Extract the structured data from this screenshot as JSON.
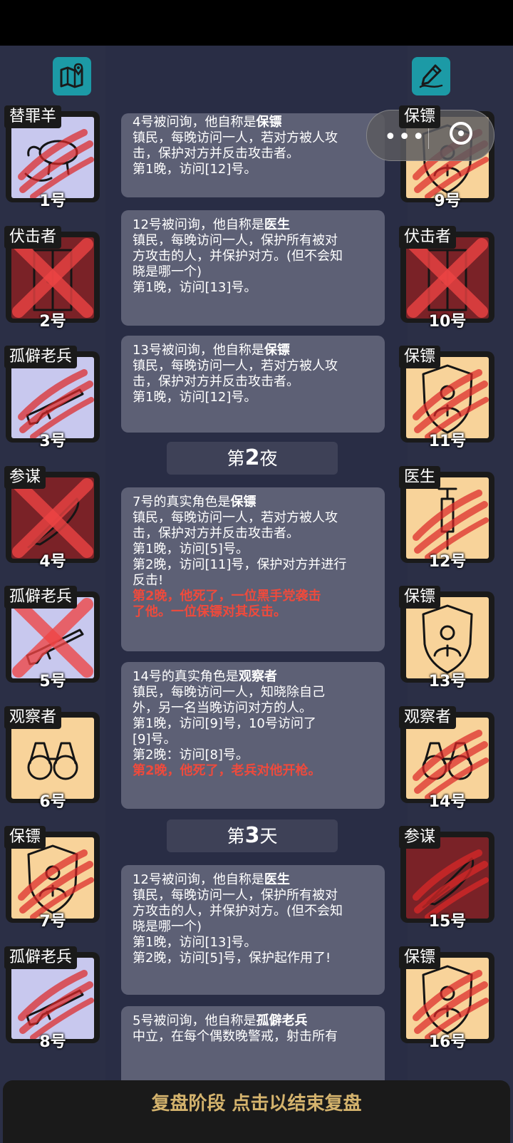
{
  "top_buttons": {
    "left_icon": "map-icon",
    "right_icon": "edit-icon"
  },
  "left_players": [
    {
      "tag": "替罪羊",
      "num": "1号",
      "icon": "goat",
      "bg": "#c8c8ee",
      "status": "scratch"
    },
    {
      "tag": "伏击者",
      "num": "2号",
      "icon": "door",
      "bg": "#7a2227",
      "status": "cross"
    },
    {
      "tag": "孤僻老兵",
      "num": "3号",
      "icon": "rifle",
      "bg": "#c8c8ee",
      "status": "scratch"
    },
    {
      "tag": "参谋",
      "num": "4号",
      "icon": "quill",
      "bg": "#7a2227",
      "status": "cross"
    },
    {
      "tag": "孤僻老兵",
      "num": "5号",
      "icon": "rifle",
      "bg": "#c8c8ee",
      "status": "cross"
    },
    {
      "tag": "观察者",
      "num": "6号",
      "icon": "binoculars",
      "bg": "#f8d39a",
      "status": "none"
    },
    {
      "tag": "保镖",
      "num": "7号",
      "icon": "shield",
      "bg": "#f8d39a",
      "status": "scratch"
    },
    {
      "tag": "孤僻老兵",
      "num": "8号",
      "icon": "rifle",
      "bg": "#c8c8ee",
      "status": "scratch"
    }
  ],
  "right_players": [
    {
      "tag": "保镖",
      "num": "9号",
      "icon": "shield",
      "bg": "#f8d39a",
      "status": "scratch"
    },
    {
      "tag": "伏击者",
      "num": "10号",
      "icon": "door",
      "bg": "#7a2227",
      "status": "cross"
    },
    {
      "tag": "保镖",
      "num": "11号",
      "icon": "shield",
      "bg": "#f8d39a",
      "status": "scratch"
    },
    {
      "tag": "医生",
      "num": "12号",
      "icon": "syringe",
      "bg": "#f8d39a",
      "status": "scratch"
    },
    {
      "tag": "保镖",
      "num": "13号",
      "icon": "shield",
      "bg": "#f8d39a",
      "status": "none"
    },
    {
      "tag": "观察者",
      "num": "14号",
      "icon": "binoculars",
      "bg": "#f8d39a",
      "status": "scratch"
    },
    {
      "tag": "参谋",
      "num": "15号",
      "icon": "quill",
      "bg": "#7a2227",
      "status": "scratch"
    },
    {
      "tag": "保镖",
      "num": "16号",
      "icon": "shield",
      "bg": "#f8d39a",
      "status": "scratch"
    }
  ],
  "log": {
    "card1": {
      "l1a": "4号被问询，他自称是",
      "l1b": "保镖",
      "l2": "镇民，每晚访问一人，若对方被人攻",
      "l3": "击，保护对方并反击攻击者。",
      "l4": "第1晚，访问[12]号。"
    },
    "card2": {
      "l1a": "12号被问询，他自称是",
      "l1b": "医生",
      "l2": "镇民，每晚访问一人，保护所有被对",
      "l3": "方攻击的人，并保护对方。(但不会知",
      "l4": "晓是哪一个)",
      "l5": "第1晚，访问[13]号。"
    },
    "card3": {
      "l1a": "13号被问询，他自称是",
      "l1b": "保镖",
      "l2": "镇民，每晚访问一人，若对方被人攻",
      "l3": "击，保护对方并反击攻击者。",
      "l4": "第1晚，访问[12]号。"
    },
    "header1": {
      "pre": "第",
      "num": "2",
      "post": "夜"
    },
    "card4": {
      "l1a": "7号的真实角色是",
      "l1b": "保镖",
      "l2": "镇民，每晚访问一人，若对方被人攻",
      "l3": "击，保护对方并反击攻击者。",
      "l4": "第1晚，访问[5]号。",
      "l5": "第2晚，访问[11]号，保护对方并进行",
      "l6": "反击!",
      "r1": "第2晚，他死了，一位黑手党袭击",
      "r2": "了他。一位保镖对其反击。"
    },
    "card5": {
      "l1a": "14号的真实角色是",
      "l1b": "观察者",
      "l2": "镇民，每晚访问一人，知晓除自己",
      "l3": "外，另一名当晚访问对方的人。",
      "l4": "第1晚，访问[9]号，10号访问了",
      "l5": "[9]号。",
      "l6": "第2晚：访问[8]号。",
      "r1": "第2晚，他死了，老兵对他开枪。"
    },
    "header2": {
      "pre": "第",
      "num": "3",
      "post": "天"
    },
    "card6": {
      "l1a": "12号被问询，他自称是",
      "l1b": "医生",
      "l2": "镇民，每晚访问一人，保护所有被对",
      "l3": "方攻击的人，并保护对方。(但不会知",
      "l4": "晓是哪一个)",
      "l5": "第1晚，访问[13]号。",
      "l6": "第2晚，访问[5]号，保护起作用了!"
    },
    "card7": {
      "l1a": "5号被问询，他自称是",
      "l1b": "孤僻老兵",
      "l2": "中立，在每个偶数晚警戒，射击所有"
    }
  },
  "bottom_label": "复盘阶段 点击以结束复盘"
}
